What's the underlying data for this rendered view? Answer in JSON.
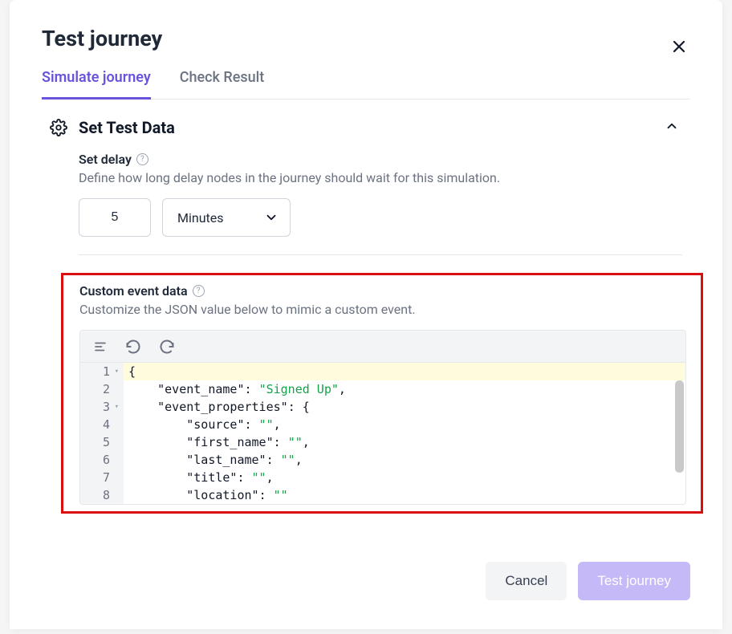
{
  "modal": {
    "title": "Test journey",
    "tabs": [
      {
        "label": "Simulate journey",
        "active": true
      },
      {
        "label": "Check Result",
        "active": false
      }
    ]
  },
  "section": {
    "title": "Set Test Data",
    "delay": {
      "label": "Set delay",
      "description": "Define how long delay nodes in the journey should wait for this simulation.",
      "value": "5",
      "unit": "Minutes"
    },
    "custom_event": {
      "label": "Custom event data",
      "description": "Customize the JSON value below to mimic a custom event."
    }
  },
  "editor": {
    "line_numbers": [
      "1",
      "2",
      "3",
      "4",
      "5",
      "6",
      "7",
      "8"
    ],
    "json": {
      "event_name": "Signed Up",
      "event_properties": {
        "source": "",
        "first_name": "",
        "last_name": "",
        "title": "",
        "location": ""
      }
    },
    "tokens": {
      "l1": "{",
      "l2_k": "\"event_name\"",
      "l2_c": ": ",
      "l2_v": "\"Signed Up\"",
      "l2_e": ",",
      "l3_k": "\"event_properties\"",
      "l3_c": ": {",
      "l4_k": "\"source\"",
      "l4_c": ": ",
      "l4_v": "\"\"",
      "l4_e": ",",
      "l5_k": "\"first_name\"",
      "l5_c": ": ",
      "l5_v": "\"\"",
      "l5_e": ",",
      "l6_k": "\"last_name\"",
      "l6_c": ": ",
      "l6_v": "\"\"",
      "l6_e": ",",
      "l7_k": "\"title\"",
      "l7_c": ": ",
      "l7_v": "\"\"",
      "l7_e": ",",
      "l8_k": "\"location\"",
      "l8_c": ": ",
      "l8_v": "\"\""
    }
  },
  "footer": {
    "cancel": "Cancel",
    "submit": "Test journey"
  }
}
